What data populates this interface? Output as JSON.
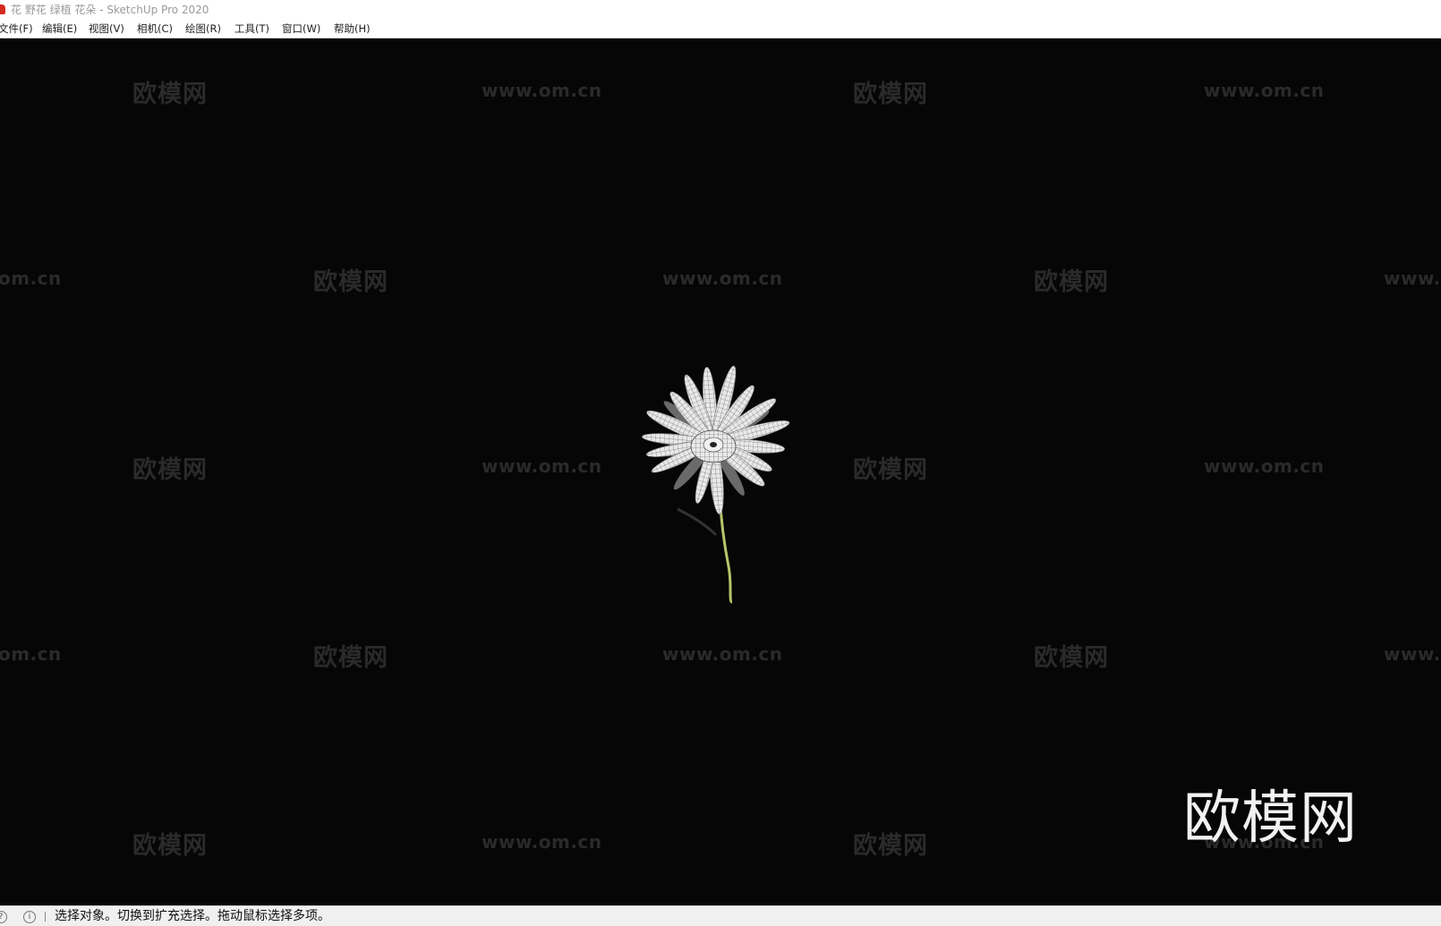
{
  "window": {
    "title": "花 野花 绿植 花朵 - SketchUp Pro 2020"
  },
  "menu": {
    "items": [
      {
        "label": "文件(F)"
      },
      {
        "label": "编辑(E)"
      },
      {
        "label": "视图(V)"
      },
      {
        "label": "相机(C)"
      },
      {
        "label": "绘图(R)"
      },
      {
        "label": "工具(T)"
      },
      {
        "label": "窗口(W)"
      },
      {
        "label": "帮助(H)"
      }
    ]
  },
  "watermark": {
    "brand": "欧模网",
    "url": "www.om.cn",
    "url_cropped_right": "www.",
    "url_cropped_left": "om.cn"
  },
  "status": {
    "text": "选择对象。切换到扩充选择。拖动鼠标选择多项。",
    "icons": [
      "question-icon",
      "info-icon"
    ]
  },
  "colors": {
    "viewport_background": "#060606",
    "watermark": "#2a2a2a",
    "logo": "#f2f2f2",
    "app_icon": "#d32a1f",
    "stem": "#b7c46a"
  }
}
